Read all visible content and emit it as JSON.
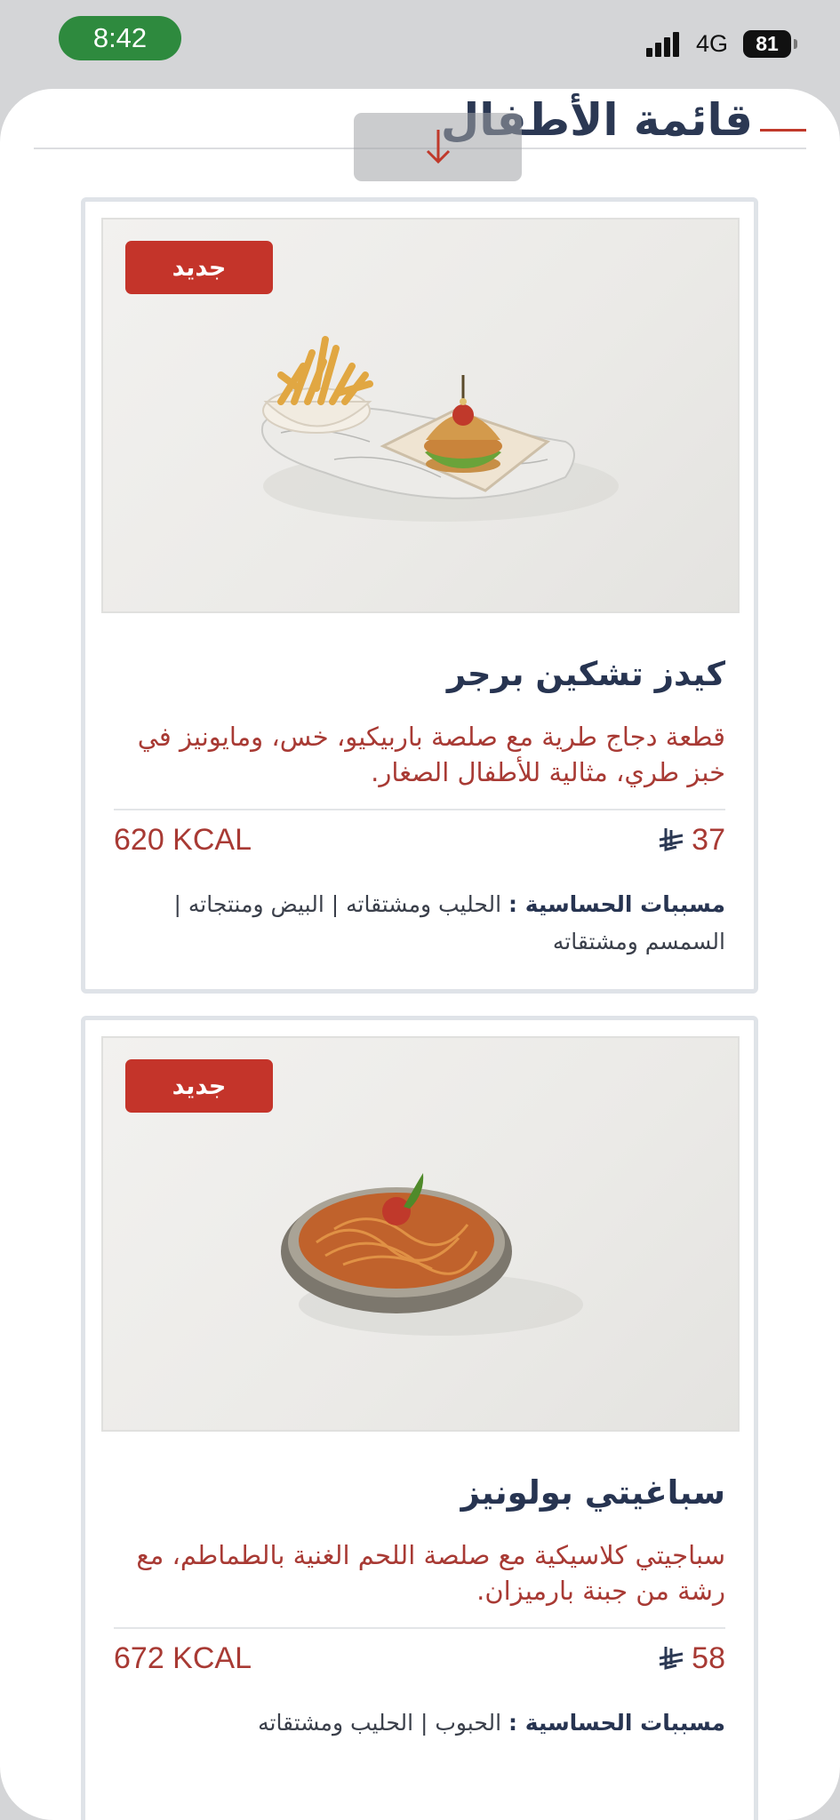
{
  "status": {
    "time": "8:42",
    "network": "4G",
    "battery": "81"
  },
  "page": {
    "title": "قائمة الأطفال"
  },
  "items": [
    {
      "badge": "جديد",
      "image_icon": "chicken-burger-photo-icon",
      "name": "كيدز تشكين برجر",
      "description": "قطعة دجاج طرية مع صلصة باربيكيو، خس، ومايونيز في خبز طري، مثالية للأطفال الصغار.",
      "kcal": "620 KCAL",
      "price": "37",
      "currency_icon": "riyal-icon",
      "allergens_label": "مسببات الحساسية :",
      "allergens": "الحليب ومشتقاته | البيض ومنتجاته | السمسم ومشتقاته"
    },
    {
      "badge": "جديد",
      "image_icon": "spaghetti-photo-icon",
      "name": "سباغيتي بولونيز",
      "description": "سباجيتي كلاسيكية مع صلصة اللحم الغنية بالطماطم، مع رشة من جبنة بارميزان.",
      "kcal": "672 KCAL",
      "price": "58",
      "currency_icon": "riyal-icon",
      "allergens_label": "مسببات الحساسية :",
      "allergens": "الحبوب | الحليب ومشتقاته"
    }
  ],
  "colors": {
    "accent": "#c4342a",
    "title": "#2b3853",
    "text_red": "#a83a34"
  }
}
